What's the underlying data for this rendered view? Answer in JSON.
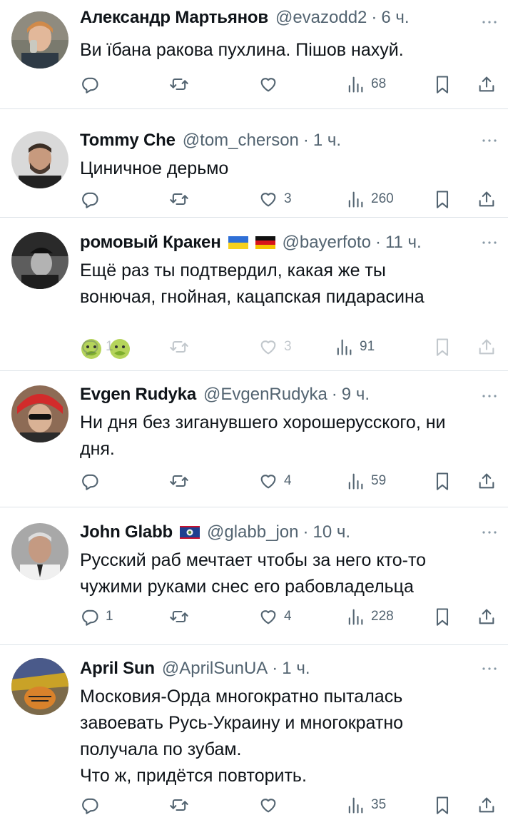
{
  "tweets": [
    {
      "name": "Александр Мартьянов",
      "handle": "@evazodd2",
      "dot": "·",
      "time": "6 ч.",
      "text": "Ви їбана ракова пухлина. Пішов нахуй.",
      "reply_count": "",
      "retweet_count": "",
      "like_count": "",
      "views": "68"
    },
    {
      "name": "Tommy Che",
      "handle": "@tom_cherson",
      "dot": "·",
      "time": "1 ч.",
      "text": "Циничное дерьмо",
      "reply_count": "",
      "retweet_count": "",
      "like_count": "3",
      "views": "260"
    },
    {
      "name": "ромовый Кракен",
      "handle": "@bayerfoto",
      "dot": "·",
      "time": "11 ч.",
      "text": "Ещё раз ты подтвердил, какая же ты\nвонючая, гнойная, кацапская пидарасина",
      "emoji": [
        "nauseated-face-emoji",
        "nauseated-face-emoji"
      ],
      "reply_count": "1",
      "retweet_count": "",
      "like_count": "3",
      "views": "91"
    },
    {
      "name": "Evgen Rudyka",
      "handle": "@EvgenRudyka",
      "dot": "·",
      "time": "9 ч.",
      "text": "Ни дня без зиганувшего хорошерусского, ни\nдня.",
      "reply_count": "",
      "retweet_count": "",
      "like_count": "4",
      "views": "59"
    },
    {
      "name": "John Glabb",
      "handle": "@glabb_jon",
      "dot": "·",
      "time": "10 ч.",
      "text": "Русский раб мечтает чтобы за него кто-то\nчужими руками снес его рабовладельца",
      "reply_count": "1",
      "retweet_count": "",
      "like_count": "4",
      "views": "228"
    },
    {
      "name": "April Sun",
      "handle": "@AprilSunUA",
      "dot": "·",
      "time": "1 ч.",
      "text": "Московия-Орда многократно пыталась\nзавоевать Русь-Украину и многократно\nполучала по зубам.\nЧто ж, придётся повторить.",
      "reply_count": "",
      "retweet_count": "",
      "like_count": "",
      "views": "35"
    }
  ],
  "icons": {
    "reply": "reply-icon",
    "retweet": "retweet-icon",
    "like": "like-icon",
    "views": "views-icon",
    "bookmark": "bookmark-icon",
    "share": "share-icon",
    "more": "more-icon"
  },
  "colors": {
    "text": "#0f1419",
    "secondary": "#536471",
    "divider": "#dde3e8",
    "background": "#ffffff"
  }
}
